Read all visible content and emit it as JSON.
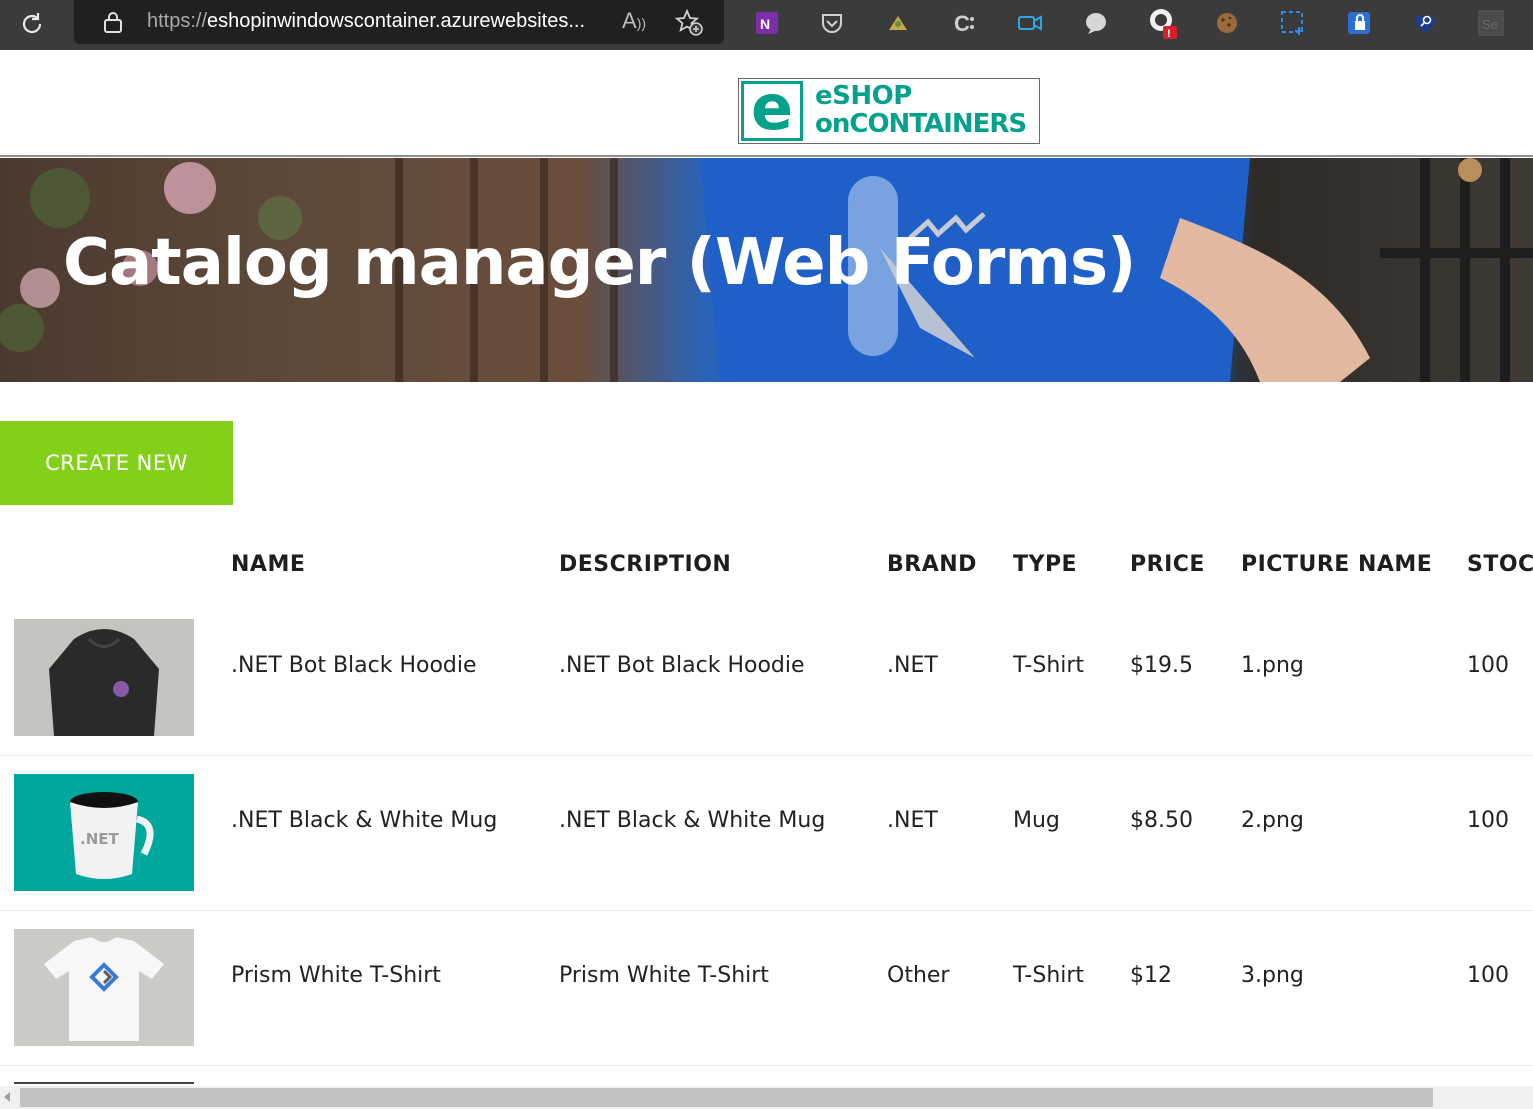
{
  "browser": {
    "url_prefix": "https://",
    "url_rest": "eshopinwindowscontainer.azurewebsites...",
    "read_aloud_icon": "read-aloud-icon",
    "favorite_icon": "add-favorite-icon",
    "extension_badge": "!"
  },
  "header": {
    "logo_line1": "eSHOP",
    "logo_line2": "onCONTAINERS",
    "logo_letter": "e"
  },
  "hero": {
    "title": "Catalog manager (Web Forms)"
  },
  "actions": {
    "create_new": "CREATE NEW"
  },
  "table": {
    "headers": [
      "NAME",
      "DESCRIPTION",
      "BRAND",
      "TYPE",
      "PRICE",
      "PICTURE NAME",
      "STOC"
    ],
    "rows": [
      {
        "name": ".NET Bot Black Hoodie",
        "description": ".NET Bot Black Hoodie",
        "brand": ".NET",
        "type": "T-Shirt",
        "price": "$19.5",
        "picture": "1.png",
        "stock": "100",
        "thumb_label": ""
      },
      {
        "name": ".NET Black & White Mug",
        "description": ".NET Black & White Mug",
        "brand": ".NET",
        "type": "Mug",
        "price": "$8.50",
        "picture": "2.png",
        "stock": "100",
        "thumb_label": ".NET"
      },
      {
        "name": "Prism White T-Shirt",
        "description": "Prism White T-Shirt",
        "brand": "Other",
        "type": "T-Shirt",
        "price": "$12",
        "picture": "3.png",
        "stock": "100",
        "thumb_label": ""
      }
    ]
  },
  "colors": {
    "brand_teal": "#05a18c",
    "create_green": "#83d01b",
    "toolbar_bg": "#3b3b3b"
  }
}
